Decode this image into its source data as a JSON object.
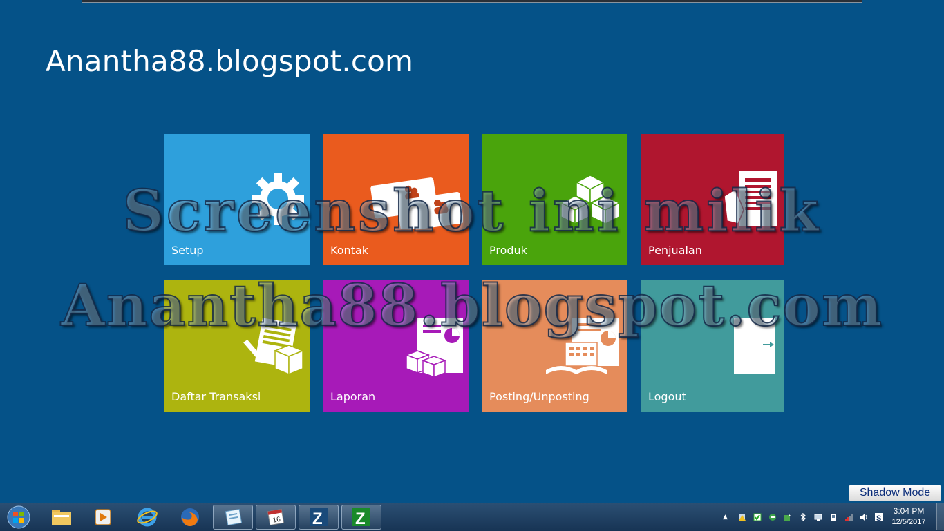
{
  "app": {
    "title": "Anantha88.blogspot.com"
  },
  "watermark": {
    "line1": "Screenshot ini milik",
    "line2": "Anantha88.blogspot.com"
  },
  "tiles": [
    {
      "label": "Setup",
      "color": "#2ea0dc",
      "icon": "gear-icon"
    },
    {
      "label": "Kontak",
      "color": "#ea5b1e",
      "icon": "contact-cards-icon"
    },
    {
      "label": "Produk",
      "color": "#4aa40c",
      "icon": "boxes-icon"
    },
    {
      "label": "Penjualan",
      "color": "#b0162f",
      "icon": "sales-document-icon"
    },
    {
      "label": "Daftar Transaksi",
      "color": "#adb40f",
      "icon": "transaction-list-icon"
    },
    {
      "label": "Laporan",
      "color": "#a71ab8",
      "icon": "report-icon"
    },
    {
      "label": "Posting/Unposting",
      "color": "#e58c5b",
      "icon": "posting-icon"
    },
    {
      "label": "Logout",
      "color": "#419b9c",
      "icon": "door-exit-icon"
    }
  ],
  "shadow_mode": {
    "label": "Shadow Mode"
  },
  "taskbar": {
    "items": [
      {
        "name": "start-button",
        "icon": "windows-orb-icon"
      },
      {
        "name": "explorer",
        "icon": "folder-icon"
      },
      {
        "name": "media-player",
        "icon": "media-player-icon"
      },
      {
        "name": "internet-explorer",
        "icon": "ie-icon"
      },
      {
        "name": "firefox",
        "icon": "firefox-icon"
      },
      {
        "name": "notes-app",
        "icon": "notepad-icon"
      },
      {
        "name": "calendar-app",
        "icon": "calendar-icon",
        "text": "16"
      },
      {
        "name": "zahir-app-1",
        "icon": "zahir-icon",
        "text": "Z"
      },
      {
        "name": "zahir-app-2",
        "icon": "zahir-icon",
        "text": "Z"
      }
    ],
    "clock": {
      "time": "3:04 PM",
      "date": "12/5/2017"
    }
  },
  "colors": {
    "background": "#055288",
    "taskbar": "#1f3f62"
  }
}
